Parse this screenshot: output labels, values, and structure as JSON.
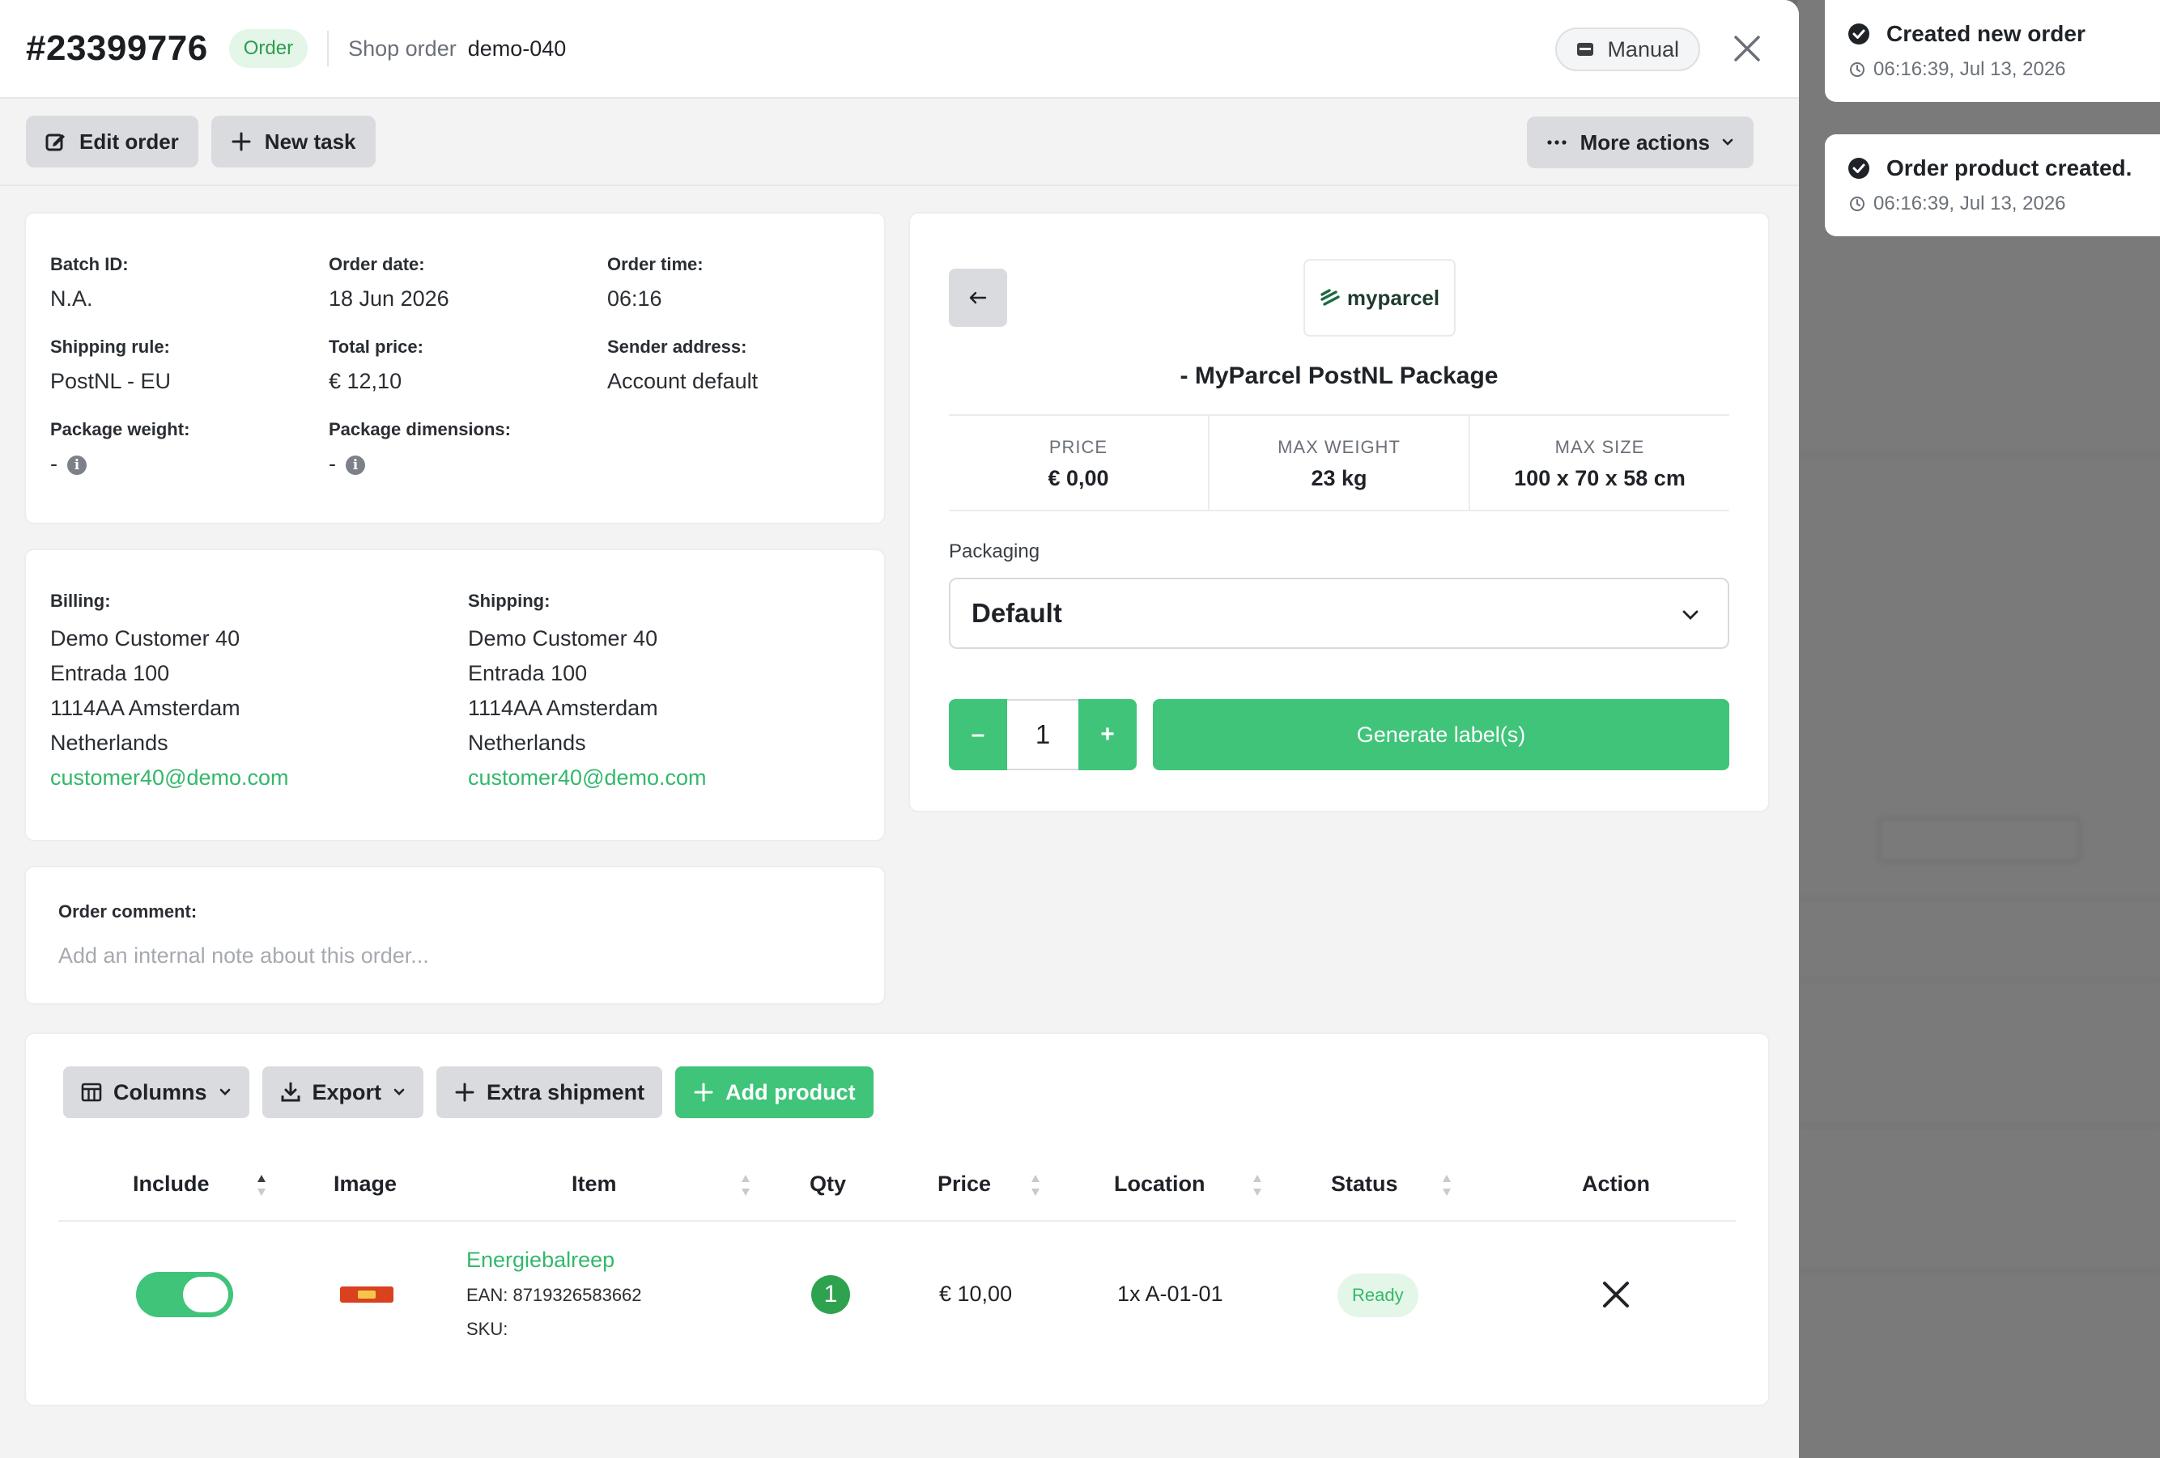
{
  "header": {
    "order_number": "#23399776",
    "order_badge": "Order",
    "shop_order_label": "Shop order",
    "shop_order_value": "demo-040",
    "source_pill": "Manual"
  },
  "toolbar": {
    "edit_order": "Edit order",
    "new_task": "New task",
    "more_actions": "More actions"
  },
  "order_details": {
    "batch_id_label": "Batch ID:",
    "batch_id": "N.A.",
    "order_date_label": "Order date:",
    "order_date": "18 Jun 2026",
    "order_time_label": "Order time:",
    "order_time": "06:16",
    "shipping_rule_label": "Shipping rule:",
    "shipping_rule": "PostNL - EU",
    "total_price_label": "Total price:",
    "total_price": "€ 12,10",
    "sender_address_label": "Sender address:",
    "sender_address": "Account default",
    "package_weight_label": "Package weight:",
    "package_weight": "-",
    "package_dimensions_label": "Package dimensions:",
    "package_dimensions": "-"
  },
  "addresses": {
    "billing_label": "Billing:",
    "billing": [
      "Demo Customer 40",
      "Entrada 100",
      "1114AA Amsterdam",
      "Netherlands"
    ],
    "billing_email": "customer40@demo.com",
    "shipping_label": "Shipping:",
    "shipping": [
      "Demo Customer 40",
      "Entrada 100",
      "1114AA Amsterdam",
      "Netherlands"
    ],
    "shipping_email": "customer40@demo.com"
  },
  "comment": {
    "label": "Order comment:",
    "placeholder": "Add an internal note about this order..."
  },
  "carrier": {
    "logo_text": "myparcel",
    "name": "- MyParcel PostNL Package",
    "price_label": "PRICE",
    "price": "€ 0,00",
    "max_weight_label": "MAX WEIGHT",
    "max_weight": "23 kg",
    "max_size_label": "MAX SIZE",
    "max_size": "100 x 70 x 58 cm",
    "packaging_label": "Packaging",
    "packaging_value": "Default",
    "quantity": "1",
    "minus": "–",
    "plus": "+",
    "generate_button": "Generate label(s)"
  },
  "products": {
    "toolbar": {
      "columns": "Columns",
      "export": "Export",
      "extra_shipment": "Extra shipment",
      "add_product": "Add product"
    },
    "columns": [
      "Include",
      "Image",
      "Item",
      "Qty",
      "Price",
      "Location",
      "Status",
      "Action"
    ],
    "rows": [
      {
        "include": true,
        "item_name": "Energiebalreep",
        "ean": "EAN: 8719326583662",
        "sku": "SKU:",
        "qty": "1",
        "price": "€ 10,00",
        "location": "1x A-01-01",
        "status": "Ready"
      }
    ]
  },
  "toasts": [
    {
      "title": "Created new order",
      "time": "06:16:39, Jul 13, 2026"
    },
    {
      "title": "Order product created.",
      "time": "06:16:39, Jul 13, 2026"
    }
  ],
  "colors": {
    "accent_green": "#3fc47a",
    "link_green": "#33b86b",
    "badge_bg": "#e3f6e8",
    "button_gray": "#d9dbde"
  }
}
